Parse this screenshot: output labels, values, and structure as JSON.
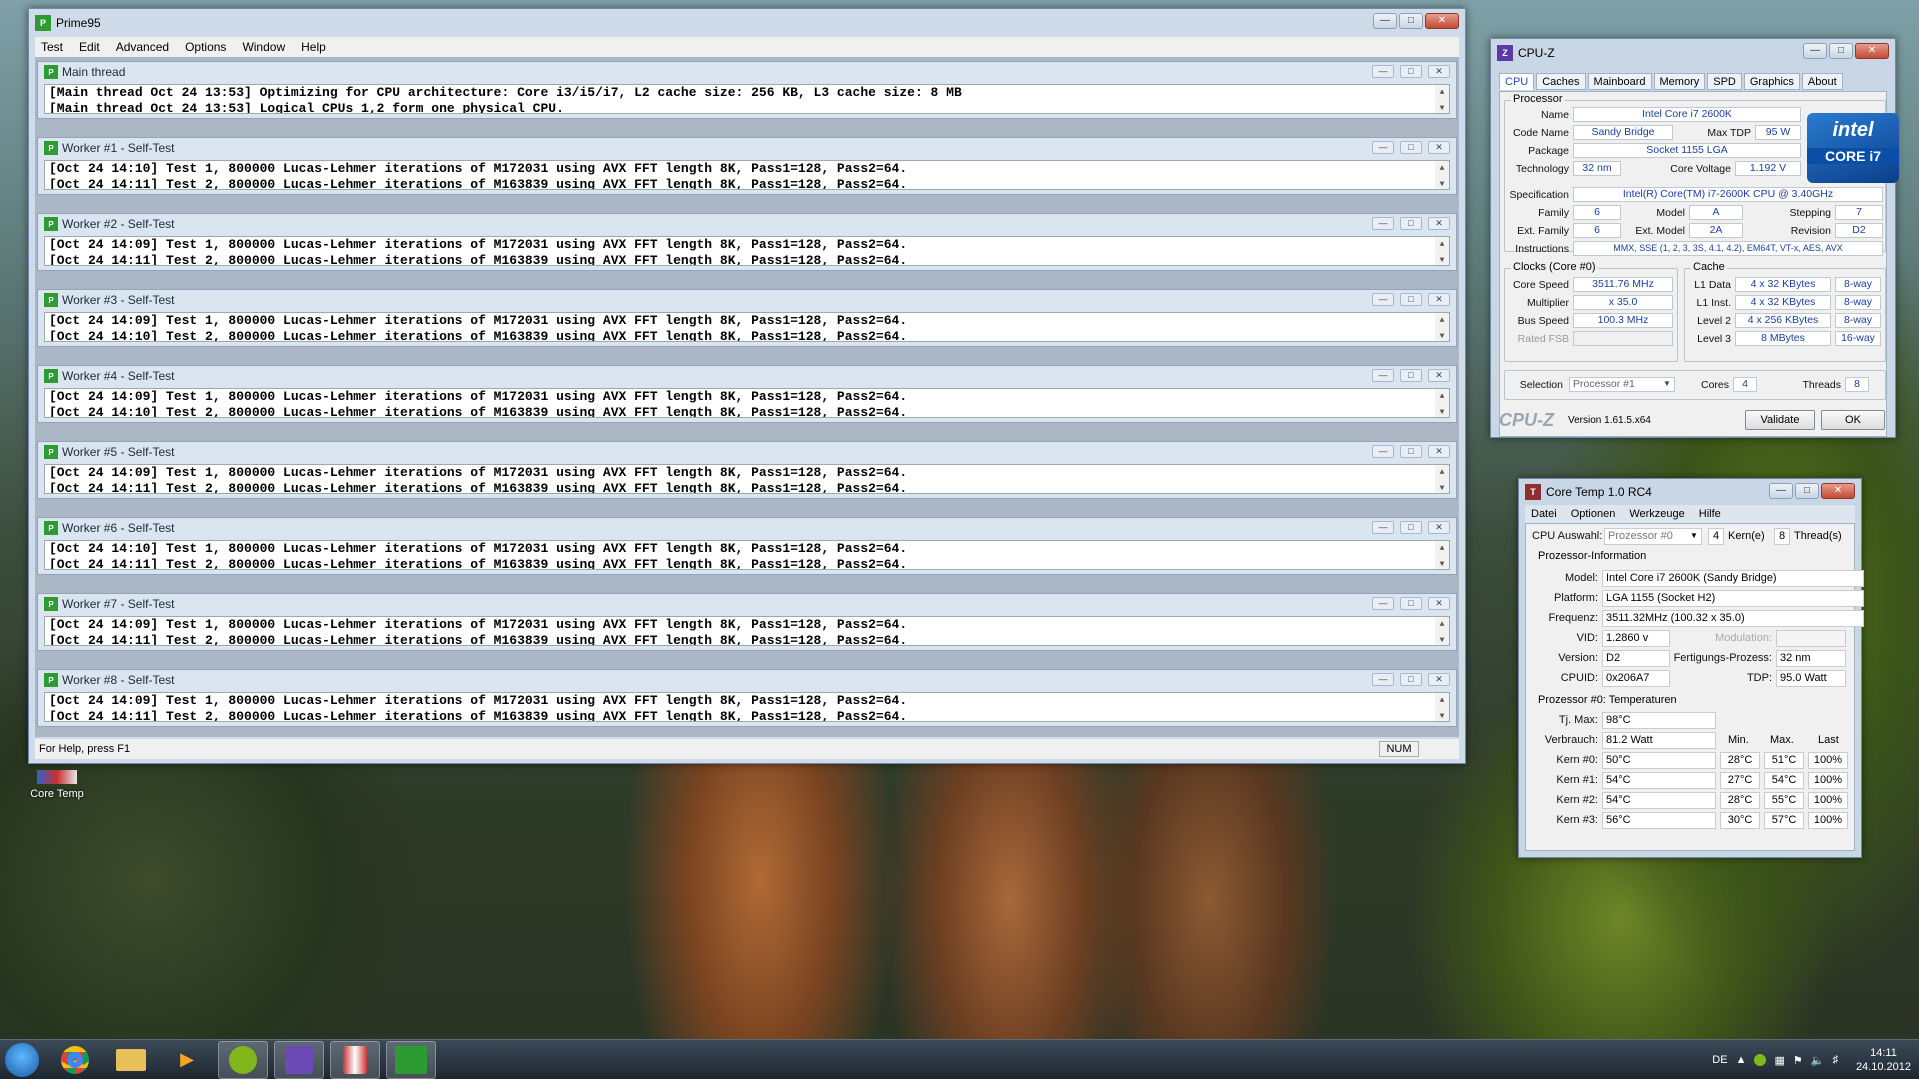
{
  "prime95": {
    "title": "Prime95",
    "menu": [
      "Test",
      "Edit",
      "Advanced",
      "Options",
      "Window",
      "Help"
    ],
    "windows": [
      {
        "title": "Main thread",
        "lines": [
          "[Main thread Oct 24 13:53] Optimizing for CPU architecture: Core i3/i5/i7, L2 cache size: 256 KB, L3 cache size: 8 MB",
          "[Main thread Oct 24 13:53] Logical CPUs 1,2 form one physical CPU."
        ]
      },
      {
        "title": "Worker #1 - Self-Test",
        "lines": [
          "[Oct 24 14:10] Test 1, 800000 Lucas-Lehmer iterations of M172031 using AVX FFT length 8K, Pass1=128, Pass2=64.",
          "[Oct 24 14:11] Test 2, 800000 Lucas-Lehmer iterations of M163839 using AVX FFT length 8K, Pass1=128, Pass2=64."
        ]
      },
      {
        "title": "Worker #2 - Self-Test",
        "lines": [
          "[Oct 24 14:09] Test 1, 800000 Lucas-Lehmer iterations of M172031 using AVX FFT length 8K, Pass1=128, Pass2=64.",
          "[Oct 24 14:11] Test 2, 800000 Lucas-Lehmer iterations of M163839 using AVX FFT length 8K, Pass1=128, Pass2=64."
        ]
      },
      {
        "title": "Worker #3 - Self-Test",
        "lines": [
          "[Oct 24 14:09] Test 1, 800000 Lucas-Lehmer iterations of M172031 using AVX FFT length 8K, Pass1=128, Pass2=64.",
          "[Oct 24 14:10] Test 2, 800000 Lucas-Lehmer iterations of M163839 using AVX FFT length 8K, Pass1=128, Pass2=64."
        ]
      },
      {
        "title": "Worker #4 - Self-Test",
        "lines": [
          "[Oct 24 14:09] Test 1, 800000 Lucas-Lehmer iterations of M172031 using AVX FFT length 8K, Pass1=128, Pass2=64.",
          "[Oct 24 14:10] Test 2, 800000 Lucas-Lehmer iterations of M163839 using AVX FFT length 8K, Pass1=128, Pass2=64."
        ]
      },
      {
        "title": "Worker #5 - Self-Test",
        "lines": [
          "[Oct 24 14:09] Test 1, 800000 Lucas-Lehmer iterations of M172031 using AVX FFT length 8K, Pass1=128, Pass2=64.",
          "[Oct 24 14:11] Test 2, 800000 Lucas-Lehmer iterations of M163839 using AVX FFT length 8K, Pass1=128, Pass2=64."
        ]
      },
      {
        "title": "Worker #6 - Self-Test",
        "lines": [
          "[Oct 24 14:10] Test 1, 800000 Lucas-Lehmer iterations of M172031 using AVX FFT length 8K, Pass1=128, Pass2=64.",
          "[Oct 24 14:11] Test 2, 800000 Lucas-Lehmer iterations of M163839 using AVX FFT length 8K, Pass1=128, Pass2=64."
        ]
      },
      {
        "title": "Worker #7 - Self-Test",
        "lines": [
          "[Oct 24 14:09] Test 1, 800000 Lucas-Lehmer iterations of M172031 using AVX FFT length 8K, Pass1=128, Pass2=64.",
          "[Oct 24 14:11] Test 2, 800000 Lucas-Lehmer iterations of M163839 using AVX FFT length 8K, Pass1=128, Pass2=64."
        ]
      },
      {
        "title": "Worker #8 - Self-Test",
        "lines": [
          "[Oct 24 14:09] Test 1, 800000 Lucas-Lehmer iterations of M172031 using AVX FFT length 8K, Pass1=128, Pass2=64.",
          "[Oct 24 14:11] Test 2, 800000 Lucas-Lehmer iterations of M163839 using AVX FFT length 8K, Pass1=128, Pass2=64."
        ]
      }
    ],
    "status": "For Help, press F1",
    "num": "NUM"
  },
  "cpuz": {
    "title": "CPU-Z",
    "tabs": [
      "CPU",
      "Caches",
      "Mainboard",
      "Memory",
      "SPD",
      "Graphics",
      "About"
    ],
    "processor_group": "Processor",
    "name_label": "Name",
    "name": "Intel Core i7 2600K",
    "codename_label": "Code Name",
    "codename": "Sandy Bridge",
    "maxtdp_label": "Max TDP",
    "maxtdp": "95 W",
    "package_label": "Package",
    "package": "Socket 1155 LGA",
    "technology_label": "Technology",
    "technology": "32 nm",
    "corevoltage_label": "Core Voltage",
    "corevoltage": "1.192 V",
    "spec_label": "Specification",
    "spec": "Intel(R) Core(TM) i7-2600K CPU @ 3.40GHz",
    "family_label": "Family",
    "family": "6",
    "model_label": "Model",
    "model": "A",
    "stepping_label": "Stepping",
    "stepping": "7",
    "extfamily_label": "Ext. Family",
    "extfamily": "6",
    "extmodel_label": "Ext. Model",
    "extmodel": "2A",
    "revision_label": "Revision",
    "revision": "D2",
    "instructions_label": "Instructions",
    "instructions": "MMX, SSE (1, 2, 3, 3S, 4.1, 4.2), EM64T, VT-x, AES, AVX",
    "intel_logo": "intel",
    "intel_sub": "CORE i7",
    "clocks_group": "Clocks (Core #0)",
    "corespeed_label": "Core Speed",
    "corespeed": "3511.76 MHz",
    "multiplier_label": "Multiplier",
    "multiplier": "x 35.0",
    "busspeed_label": "Bus Speed",
    "busspeed": "100.3 MHz",
    "ratedfsb_label": "Rated FSB",
    "ratedfsb": "",
    "cache_group": "Cache",
    "l1d_label": "L1 Data",
    "l1d": "4 x 32 KBytes",
    "l1d_way": "8-way",
    "l1i_label": "L1 Inst.",
    "l1i": "4 x 32 KBytes",
    "l1i_way": "8-way",
    "l2_label": "Level 2",
    "l2": "4 x 256 KBytes",
    "l2_way": "8-way",
    "l3_label": "Level 3",
    "l3": "8 MBytes",
    "l3_way": "16-way",
    "selection_label": "Selection",
    "selection": "Processor #1",
    "cores_label": "Cores",
    "cores": "4",
    "threads_label": "Threads",
    "threads": "8",
    "brand": "CPU-Z",
    "version": "Version 1.61.5.x64",
    "validate": "Validate",
    "ok": "OK"
  },
  "coretemp": {
    "title": "Core Temp 1.0 RC4",
    "menu": [
      "Datei",
      "Optionen",
      "Werkzeuge",
      "Hilfe"
    ],
    "cpu_select_label": "CPU Auswahl:",
    "cpu_select": "Prozessor #0",
    "cores": "4",
    "cores_label": "Kern(e)",
    "threads": "8",
    "threads_label": "Thread(s)",
    "info_header": "Prozessor-Information",
    "model_label": "Model:",
    "model": "Intel Core i7 2600K (Sandy Bridge)",
    "platform_label": "Platform:",
    "platform": "LGA 1155 (Socket H2)",
    "freq_label": "Frequenz:",
    "freq": "3511.32MHz (100.32 x 35.0)",
    "vid_label": "VID:",
    "vid": "1.2860 v",
    "modulation_label": "Modulation:",
    "modulation": "",
    "version_label": "Version:",
    "version": "D2",
    "process_label": "Fertigungs-Prozess:",
    "process": "32 nm",
    "cpuid_label": "CPUID:",
    "cpuid": "0x206A7",
    "tdp_label": "TDP:",
    "tdp": "95.0 Watt",
    "temps_header": "Prozessor #0: Temperaturen",
    "tjmax_label": "Tj. Max:",
    "tjmax": "98°C",
    "power_label": "Verbrauch:",
    "power": "81.2 Watt",
    "col_min": "Min.",
    "col_max": "Max.",
    "col_load": "Last",
    "kerne": [
      {
        "label": "Kern #0:",
        "temp": "50°C",
        "min": "28°C",
        "max": "51°C",
        "load": "100%"
      },
      {
        "label": "Kern #1:",
        "temp": "54°C",
        "min": "27°C",
        "max": "54°C",
        "load": "100%"
      },
      {
        "label": "Kern #2:",
        "temp": "54°C",
        "min": "28°C",
        "max": "55°C",
        "load": "100%"
      },
      {
        "label": "Kern #3:",
        "temp": "56°C",
        "min": "30°C",
        "max": "57°C",
        "load": "100%"
      }
    ]
  },
  "desktop": {
    "icon_label": "Core Temp"
  },
  "taskbar": {
    "apps": [
      "start-orb",
      "chrome-icon",
      "explorer-icon",
      "media-player-icon",
      "spotify-icon",
      "cpuz-icon",
      "coretemp-icon",
      "prime95-icon"
    ],
    "language": "DE",
    "time": "14:11",
    "date": "24.10.2012"
  }
}
